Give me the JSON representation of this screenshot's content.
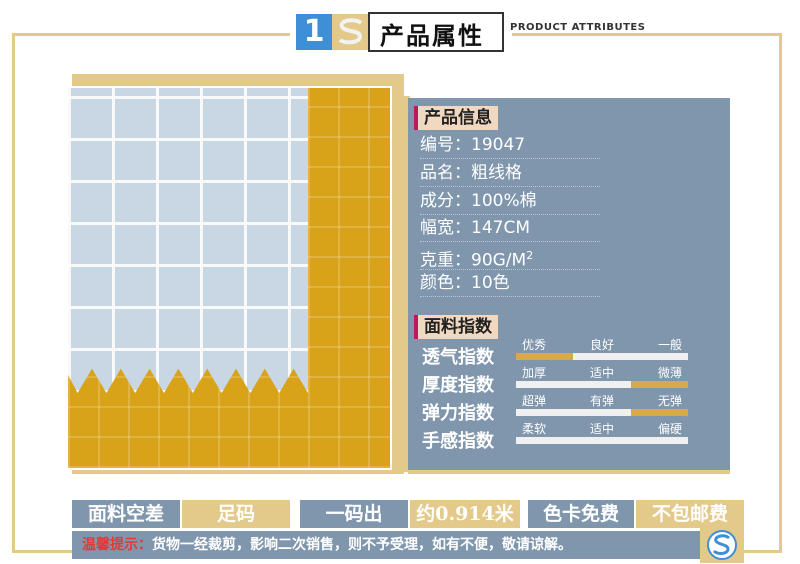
{
  "header": {
    "number": "1",
    "title": "产品属性",
    "subtitle": "PRODUCT ATTRIBUTES"
  },
  "product_info": {
    "section_title": "产品信息",
    "rows": [
      {
        "label": "编号：",
        "value": "19047"
      },
      {
        "label": "品名：",
        "value": "粗线格"
      },
      {
        "label": "成分：",
        "value": "100%棉"
      },
      {
        "label": "幅宽：",
        "value": "147CM"
      },
      {
        "label": "克重：",
        "value": "90G/M",
        "sup": "2"
      },
      {
        "label": "颜色：",
        "value": "10色"
      }
    ]
  },
  "fabric_index": {
    "section_title": "面料指数",
    "rows": [
      {
        "label": "透气指数",
        "options": [
          "优秀",
          "良好",
          "一般"
        ],
        "selected": 0
      },
      {
        "label": "厚度指数",
        "options": [
          "加厚",
          "适中",
          "微薄"
        ],
        "selected": 2
      },
      {
        "label": "弹力指数",
        "options": [
          "超弹",
          "有弹",
          "无弹"
        ],
        "selected": 2
      },
      {
        "label": "手感指数",
        "options": [
          "柔软",
          "适中",
          "偏硬"
        ],
        "selected": -1
      }
    ]
  },
  "footer": {
    "items": [
      "面料空差",
      "足码",
      "一码出",
      "约0.914米",
      "色卡免费",
      "不包邮费"
    ],
    "warning_prefix": "温馨提示：",
    "warning_text": "货物一经裁剪，影响二次销售，则不予受理，如有不便，敬请谅解。"
  },
  "colors": {
    "accent_gold": "#e3c98a",
    "panel_blue": "#7f96ad",
    "title_pink": "#c2185b",
    "fabric_yellow": "#d8a318",
    "fabric_blue": "#c9d6e4"
  },
  "icons": [
    "brand-s-logo-icon",
    "brand-s-badge-icon"
  ]
}
